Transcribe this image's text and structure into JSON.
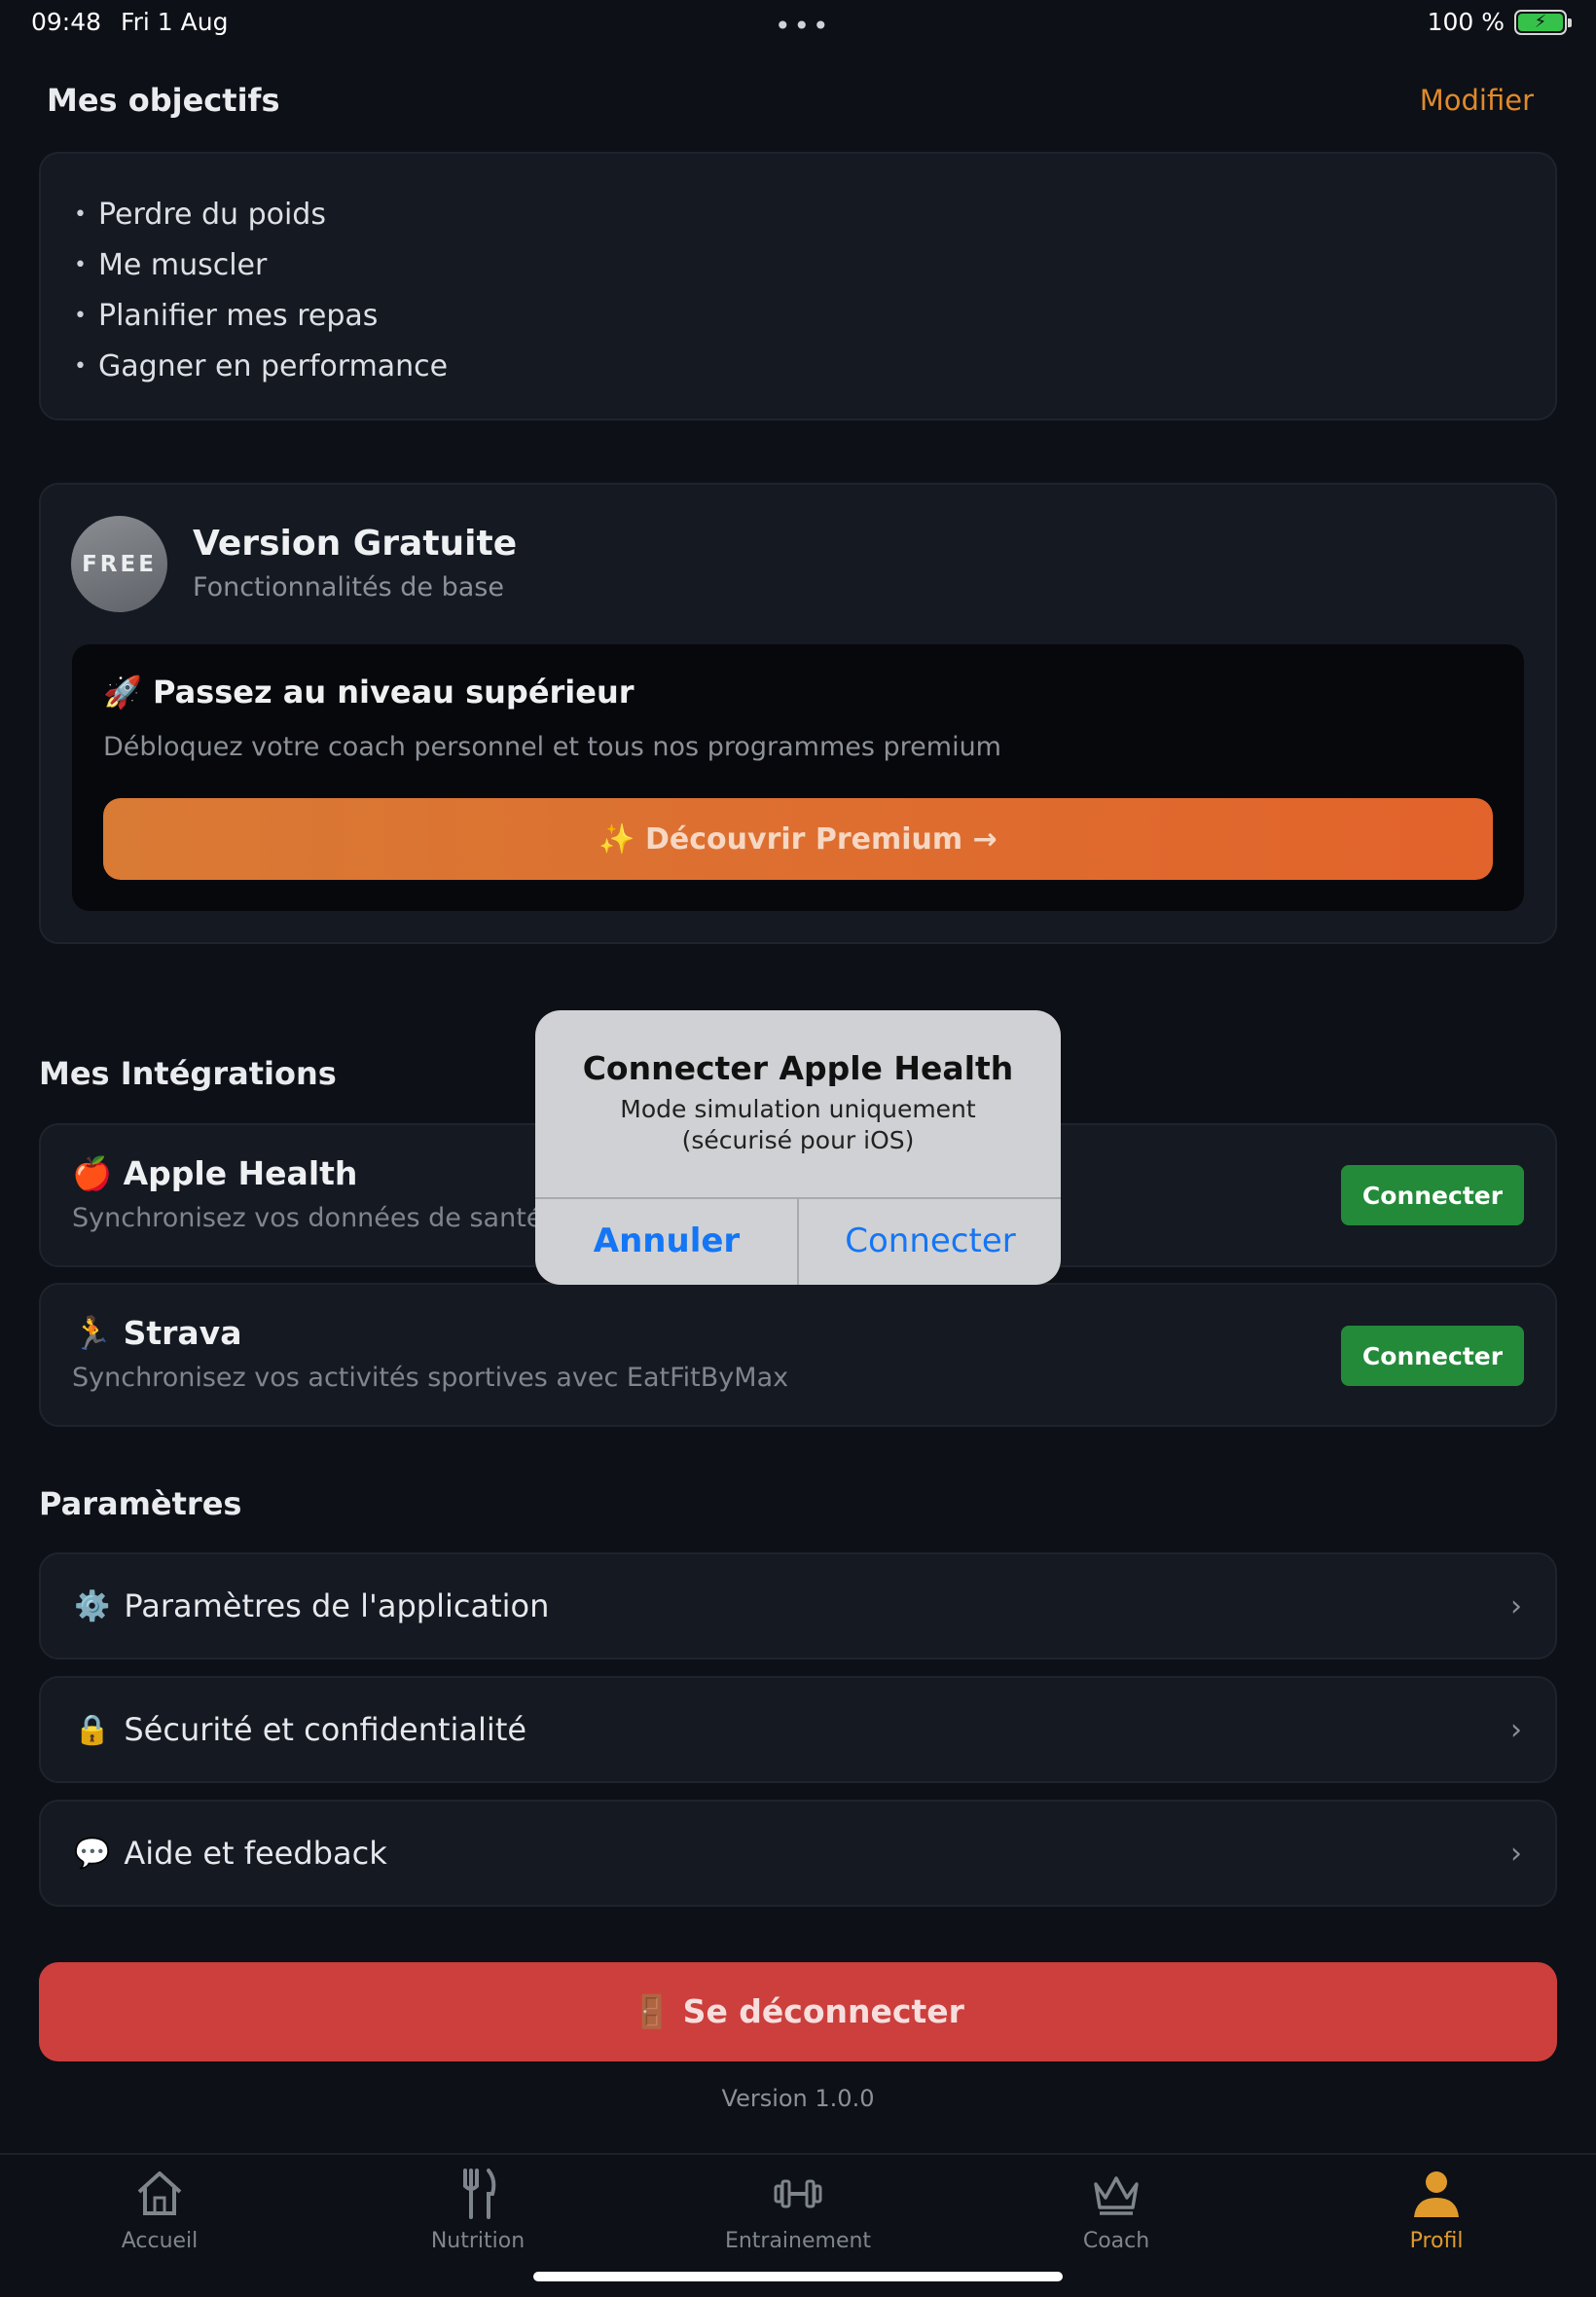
{
  "status_bar": {
    "time": "09:48",
    "date": "Fri 1 Aug",
    "dots": "•••",
    "battery": "100 %"
  },
  "objectives": {
    "title": "Mes objectifs",
    "edit_label": "Modifier",
    "items": [
      "Perdre du poids",
      "Me muscler",
      "Planifier mes repas",
      "Gagner en performance"
    ]
  },
  "plan": {
    "badge": "FREE",
    "title": "Version Gratuite",
    "subtitle": "Fonctionnalités de base",
    "promo_title": "🚀 Passez au niveau supérieur",
    "promo_subtitle": "Débloquez votre coach personnel et tous nos programmes premium",
    "premium_button": "✨ Découvrir Premium →"
  },
  "integrations": {
    "title": "Mes Intégrations",
    "items": [
      {
        "icon": "🍎",
        "name": "Apple Health",
        "description": "Synchronisez vos données de santé a",
        "button": "Connecter"
      },
      {
        "icon": "🏃",
        "name": "Strava",
        "description": "Synchronisez vos activités sportives avec EatFitByMax",
        "button": "Connecter"
      }
    ]
  },
  "settings": {
    "title": "Paramètres",
    "items": [
      {
        "icon": "⚙️",
        "label": "Paramètres de l'application"
      },
      {
        "icon": "🔒",
        "label": "Sécurité et confidentialité"
      },
      {
        "icon": "💬",
        "label": "Aide et feedback"
      }
    ],
    "chevron": "›"
  },
  "logout": {
    "label": "🚪 Se déconnecter"
  },
  "version": "Version 1.0.0",
  "tabs": [
    {
      "icon": "home-icon",
      "label": "Accueil"
    },
    {
      "icon": "fork-knife-icon",
      "label": "Nutrition"
    },
    {
      "icon": "dumbbell-icon",
      "label": "Entrainement"
    },
    {
      "icon": "crown-icon",
      "label": "Coach"
    },
    {
      "icon": "person-icon",
      "label": "Profil",
      "active": true
    }
  ],
  "modal": {
    "title": "Connecter Apple Health",
    "message": "Mode simulation uniquement (sécurisé pour iOS)",
    "cancel": "Annuler",
    "confirm": "Connecter"
  },
  "colors": {
    "accent": "#e09a2b",
    "premium": "#e2632b",
    "connect": "#238a3a",
    "logout": "#cc3f3c",
    "link_blue": "#1476f5"
  }
}
